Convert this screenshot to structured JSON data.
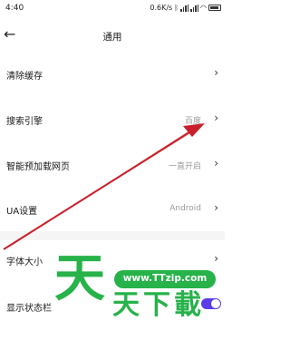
{
  "status": {
    "time": "4:40",
    "speed": "0.6K/s"
  },
  "header": {
    "title": "通用"
  },
  "settings": [
    {
      "label": "清除缓存",
      "value": ""
    },
    {
      "label": "搜索引擎",
      "value": "百度"
    },
    {
      "label": "智能预加载网页",
      "value": "一直开启"
    },
    {
      "label": "UA设置",
      "value": "Android"
    },
    {
      "label": "字体大小",
      "value": ""
    },
    {
      "label": "显示状态栏",
      "value": ""
    }
  ],
  "toggle": {
    "status_bar_on": true
  },
  "watermark": {
    "big": "天",
    "url": "www.TTzip.com",
    "small": "天下載"
  },
  "colors": {
    "accent": "#5b3de8",
    "arrow": "#c8202a",
    "watermark": "#27b24a"
  }
}
